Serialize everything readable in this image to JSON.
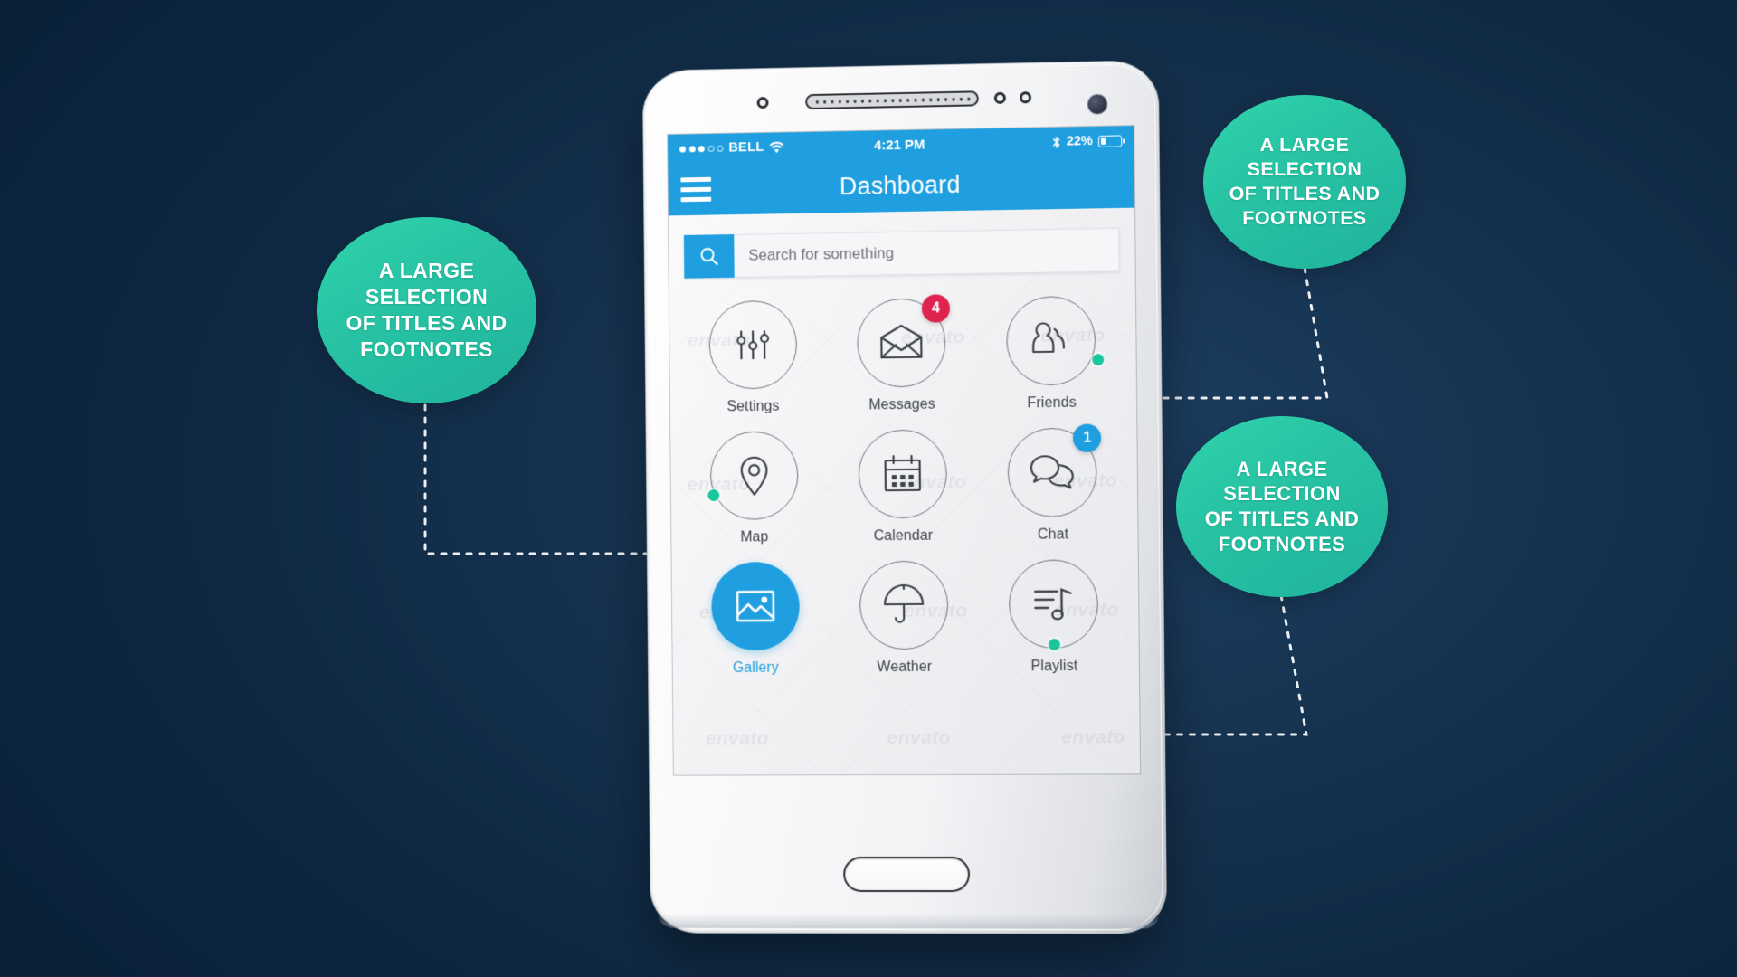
{
  "background": {
    "color_dark": "#0a2138",
    "color_mid": "#16324f",
    "color_light": "#1d4064"
  },
  "theme": {
    "accent_blue": "#1f9fe0",
    "bubble_green": "#27c2a3",
    "badge_red": "#e0234e",
    "badge_blue": "#1f9fe0",
    "status_dot_green": "#19c79a",
    "screen_bg": "#f2f2f4",
    "icon_stroke": "#3e434b"
  },
  "device": {
    "hardware": {
      "sensor_left_icon": "proximity-sensor-icon",
      "speaker_icon": "earpiece-speaker-icon",
      "sensor_right_a_icon": "light-sensor-icon",
      "sensor_right_b_icon": "ir-sensor-icon",
      "camera_icon": "front-camera-icon",
      "home_button_label": "Home"
    }
  },
  "statusbar": {
    "signal_total": 5,
    "signal_filled": 3,
    "carrier": "BELL",
    "wifi_icon": "wifi-icon",
    "time": "4:21 PM",
    "bluetooth_icon": "bluetooth-icon",
    "battery_percent": "22%",
    "battery_level": 22,
    "battery_icon": "battery-icon"
  },
  "navbar": {
    "menu_icon": "hamburger-menu-icon",
    "title": "Dashboard"
  },
  "search": {
    "icon": "search-icon",
    "placeholder": "Search for something",
    "value": ""
  },
  "tiles": [
    {
      "id": "settings",
      "label": "Settings",
      "icon": "sliders-icon",
      "active": false,
      "badge": null,
      "badge_color": null,
      "status_dot": false
    },
    {
      "id": "messages",
      "label": "Messages",
      "icon": "envelope-icon",
      "active": false,
      "badge": "4",
      "badge_color": "red",
      "status_dot": false
    },
    {
      "id": "friends",
      "label": "Friends",
      "icon": "people-icon",
      "active": false,
      "badge": null,
      "badge_color": null,
      "status_dot": true
    },
    {
      "id": "map",
      "label": "Map",
      "icon": "map-pin-icon",
      "active": false,
      "badge": null,
      "badge_color": null,
      "status_dot": true
    },
    {
      "id": "calendar",
      "label": "Calendar",
      "icon": "calendar-icon",
      "active": false,
      "badge": null,
      "badge_color": null,
      "status_dot": false
    },
    {
      "id": "chat",
      "label": "Chat",
      "icon": "chat-bubbles-icon",
      "active": false,
      "badge": "1",
      "badge_color": "blue",
      "status_dot": false
    },
    {
      "id": "gallery",
      "label": "Gallery",
      "icon": "image-icon",
      "active": true,
      "badge": null,
      "badge_color": null,
      "status_dot": false
    },
    {
      "id": "weather",
      "label": "Weather",
      "icon": "umbrella-icon",
      "active": false,
      "badge": null,
      "badge_color": null,
      "status_dot": false
    },
    {
      "id": "playlist",
      "label": "Playlist",
      "icon": "playlist-music-icon",
      "active": false,
      "badge": null,
      "badge_color": null,
      "status_dot": true
    }
  ],
  "callouts": [
    {
      "id": "left",
      "text": "A LARGE\nSELECTION\nOF TITLES AND\nFOOTNOTES",
      "connects_to": "map"
    },
    {
      "id": "top-right",
      "text": "A LARGE\nSELECTION\nOF TITLES AND\nFOOTNOTES",
      "connects_to": "friends"
    },
    {
      "id": "bottom-right",
      "text": "A LARGE\nSELECTION\nOF TITLES AND\nFOOTNOTES",
      "connects_to": "playlist"
    }
  ],
  "watermarks": {
    "text": "envato"
  }
}
